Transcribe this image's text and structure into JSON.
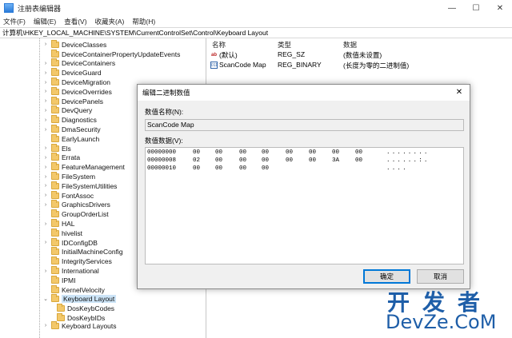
{
  "window": {
    "title": "注册表编辑器",
    "minimize": "—",
    "maximize": "☐",
    "close": "✕"
  },
  "menu": [
    "文件(F)",
    "编辑(E)",
    "查看(V)",
    "收藏夹(A)",
    "帮助(H)"
  ],
  "address": "计算机\\HKEY_LOCAL_MACHINE\\SYSTEM\\CurrentControlSet\\Control\\Keyboard Layout",
  "tree": {
    "items": [
      {
        "label": "DeviceClasses",
        "expander": "›"
      },
      {
        "label": "DeviceContainerPropertyUpdateEvents",
        "expander": ""
      },
      {
        "label": "DeviceContainers",
        "expander": "›"
      },
      {
        "label": "DeviceGuard",
        "expander": "›"
      },
      {
        "label": "DeviceMigration",
        "expander": "›"
      },
      {
        "label": "DeviceOverrides",
        "expander": "›"
      },
      {
        "label": "DevicePanels",
        "expander": "›"
      },
      {
        "label": "DevQuery",
        "expander": "›"
      },
      {
        "label": "Diagnostics",
        "expander": "›"
      },
      {
        "label": "DmaSecurity",
        "expander": "›"
      },
      {
        "label": "EarlyLaunch",
        "expander": ""
      },
      {
        "label": "Els",
        "expander": "›"
      },
      {
        "label": "Errata",
        "expander": "›"
      },
      {
        "label": "FeatureManagement",
        "expander": "›"
      },
      {
        "label": "FileSystem",
        "expander": "›"
      },
      {
        "label": "FileSystemUtilities",
        "expander": "›"
      },
      {
        "label": "FontAssoc",
        "expander": "›"
      },
      {
        "label": "GraphicsDrivers",
        "expander": "›"
      },
      {
        "label": "GroupOrderList",
        "expander": ""
      },
      {
        "label": "HAL",
        "expander": "›"
      },
      {
        "label": "hivelist",
        "expander": ""
      },
      {
        "label": "IDConfigDB",
        "expander": "›"
      },
      {
        "label": "InitialMachineConfig",
        "expander": ""
      },
      {
        "label": "IntegrityServices",
        "expander": ""
      },
      {
        "label": "International",
        "expander": "›"
      },
      {
        "label": "IPMI",
        "expander": ""
      },
      {
        "label": "KernelVelocity",
        "expander": ""
      },
      {
        "label": "Keyboard Layout",
        "expander": "⌄"
      }
    ],
    "children": [
      {
        "label": "DosKeybCodes"
      },
      {
        "label": "DosKeybIDs"
      }
    ],
    "partial": "Keyboard Layouts"
  },
  "values": {
    "headers": {
      "name": "名称",
      "type": "类型",
      "data": "数据"
    },
    "rows": [
      {
        "icon": "ab",
        "name": "(默认)",
        "type": "REG_SZ",
        "data": "(数值未设置)"
      },
      {
        "icon": "011",
        "name": "ScanCode Map",
        "type": "REG_BINARY",
        "data": "(长度为零的二进制值)"
      }
    ]
  },
  "dialog": {
    "title": "编辑二进制数值",
    "close": "✕",
    "name_label": "数值名称(N):",
    "name_value": "ScanCode Map",
    "data_label": "数值数据(V):",
    "hex_rows": [
      {
        "addr": "00000000",
        "bytes": [
          "00",
          "00",
          "00",
          "00",
          "00",
          "00",
          "00",
          "00"
        ],
        "ascii": "........"
      },
      {
        "addr": "00000008",
        "bytes": [
          "02",
          "00",
          "00",
          "00",
          "00",
          "00",
          "3A",
          "00"
        ],
        "ascii": "......:."
      },
      {
        "addr": "00000010",
        "bytes": [
          "00",
          "00",
          "00",
          "00",
          "",
          "",
          "",
          ""
        ],
        "ascii": "...."
      }
    ],
    "ok": "确定",
    "cancel": "取消"
  },
  "watermark": {
    "cn": "开发者",
    "en": "DevZe.CoM"
  },
  "colors": {
    "selection": "#cce4f7",
    "folder": "#f3c86a",
    "accent": "#0078d7",
    "watermark": "#1e5ea8"
  }
}
